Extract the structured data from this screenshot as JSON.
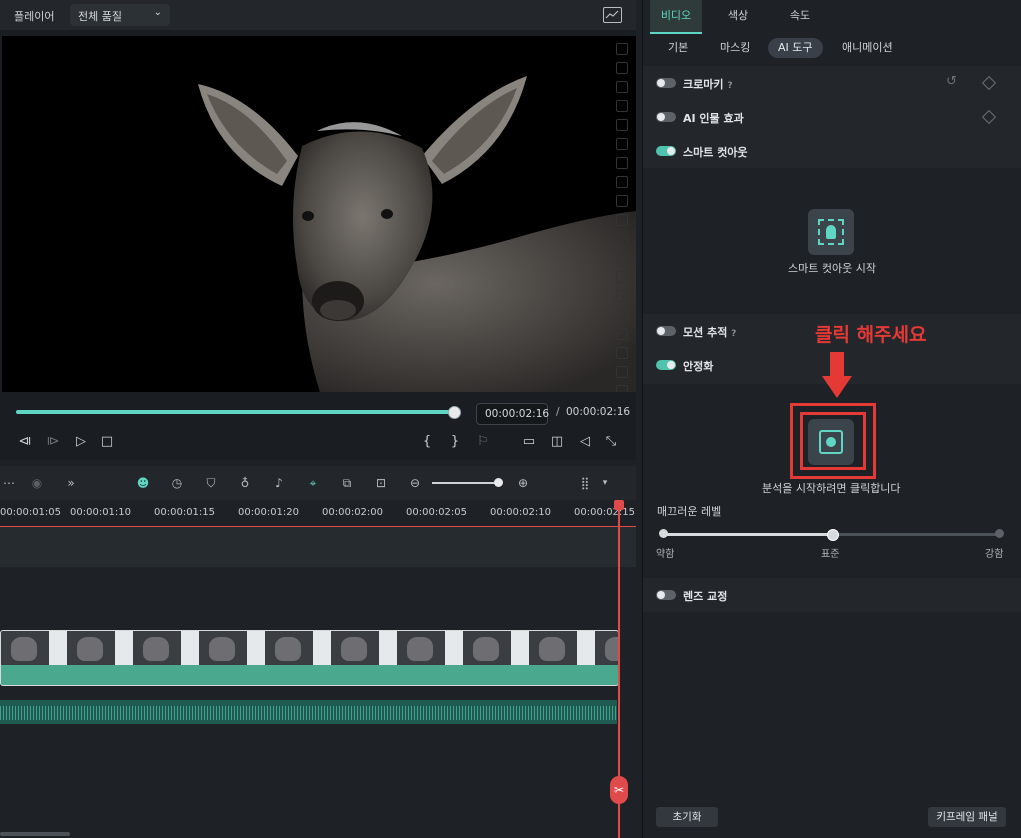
{
  "player": {
    "title": "플레이어",
    "quality": "전체 품질",
    "current_time": "00:00:02:16",
    "time_separator": "/",
    "total_time": "00:00:02:16",
    "progress": 1.0,
    "mark_in": "{",
    "mark_out": "}"
  },
  "timeline": {
    "ruler_labels": [
      "00:00:01:05",
      "00:00:01:10",
      "00:00:01:15",
      "00:00:01:20",
      "00:00:02:00",
      "00:00:02:05",
      "00:00:02:10",
      "00:00:02:15"
    ],
    "zoom_level": 0.95
  },
  "panel": {
    "top_tabs": [
      "비디오",
      "색상",
      "속도"
    ],
    "sub_tabs": [
      "기본",
      "마스킹",
      "AI 도구",
      "애니메이션"
    ],
    "chroma_key": "크로마키",
    "ai_portrait": "AI 인물 효과",
    "smart_cutout": "스마트 컷아웃",
    "smart_cutout_start": "스마트 컷아웃 시작",
    "motion_tracking": "모션 추적",
    "stabilization": "안정화",
    "annotation": "클릭 해주세요",
    "analysis_caption": "분석을 시작하려면 클릭합니다",
    "smoothness_label": "매끄러운 레벨",
    "smoothness_value": 0.5,
    "level_low": "약함",
    "level_mid": "표준",
    "level_high": "강함",
    "lens_correction": "렌즈 교정",
    "reset_button": "초기화",
    "keyframe_button": "키프레임 패널",
    "help_glyph": "?"
  },
  "colors": {
    "accent": "#5fd6c3",
    "playhead": "#e04a4a",
    "annotation": "#e53935"
  }
}
